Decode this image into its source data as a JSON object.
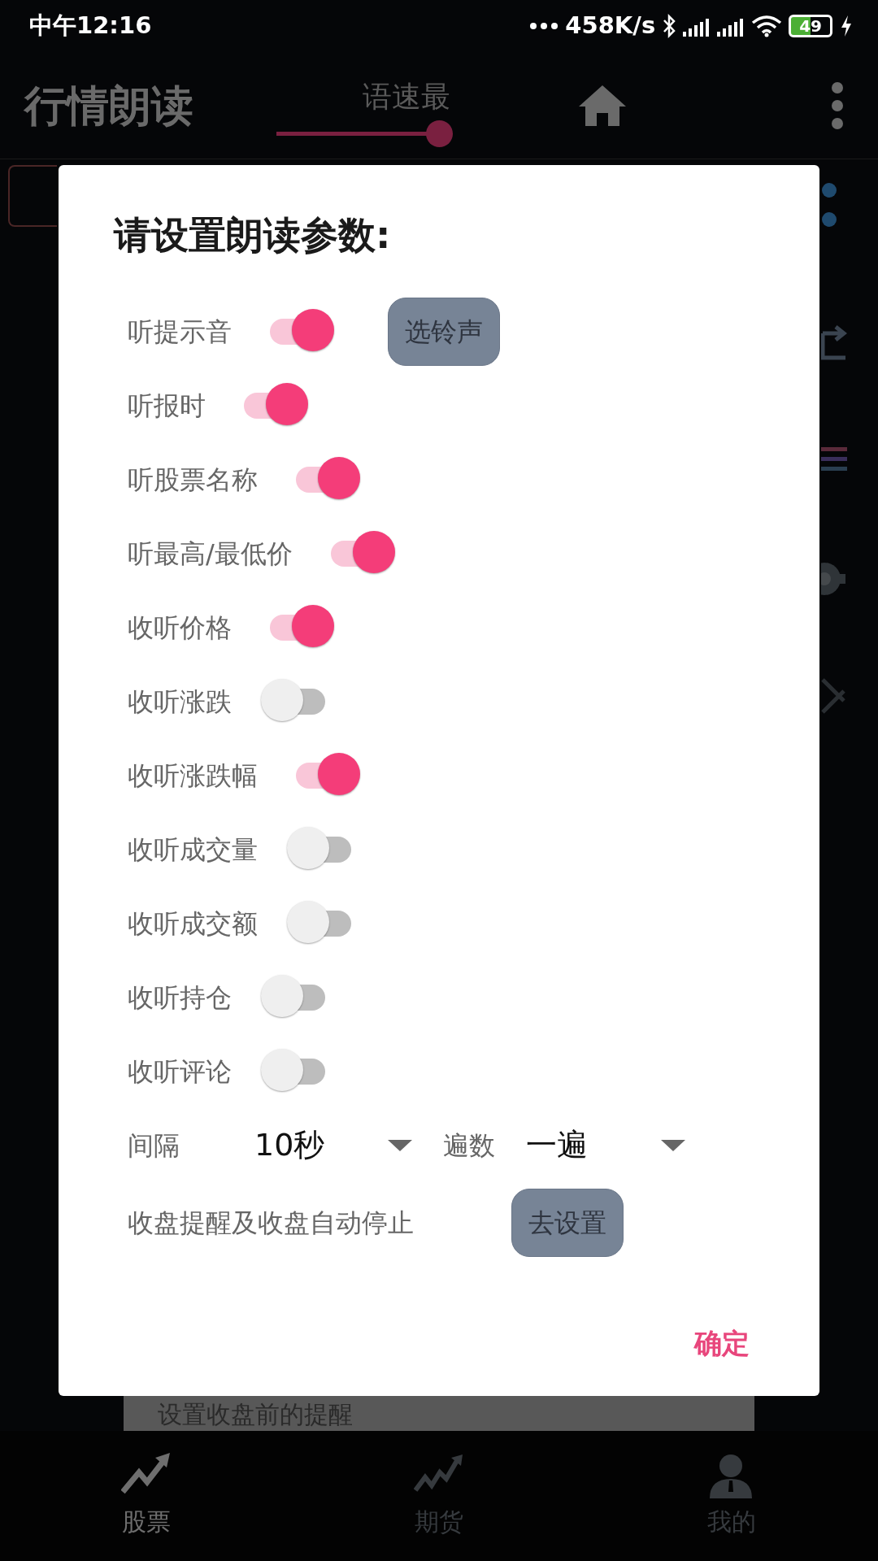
{
  "status_bar": {
    "time": "中午12:16",
    "network_speed": "458K/s",
    "battery": "49"
  },
  "app_bar": {
    "title": "行情朗读",
    "speed_label": "语速最",
    "speed_slider": {
      "level": 1
    }
  },
  "background": {
    "reminder_strip": "设置收盘前的提醒"
  },
  "dialog": {
    "title": "请设置朗读参数:",
    "options": [
      {
        "label": "听提示音",
        "on": true,
        "button": "选铃声"
      },
      {
        "label": "听报时",
        "on": true
      },
      {
        "label": "听股票名称",
        "on": true
      },
      {
        "label": "听最高/最低价",
        "on": true
      },
      {
        "label": "收听价格",
        "on": true
      },
      {
        "label": "收听涨跌",
        "on": false
      },
      {
        "label": "收听涨跌幅",
        "on": true
      },
      {
        "label": "收听成交量",
        "on": false
      },
      {
        "label": "收听成交额",
        "on": false
      },
      {
        "label": "收听持仓",
        "on": false
      },
      {
        "label": "收听评论",
        "on": false
      }
    ],
    "interval": {
      "label": "间隔",
      "value": "10秒"
    },
    "repeat": {
      "label": "遍数",
      "value": "一遍"
    },
    "close_reminder": {
      "label": "收盘提醒及收盘自动停止",
      "button": "去设置"
    },
    "confirm": "确定"
  },
  "bottom_nav": [
    {
      "label": "股票",
      "selected": true,
      "kind": "stocks"
    },
    {
      "label": "期货",
      "selected": false,
      "kind": "futures"
    },
    {
      "label": "我的",
      "selected": false,
      "kind": "profile"
    }
  ]
}
